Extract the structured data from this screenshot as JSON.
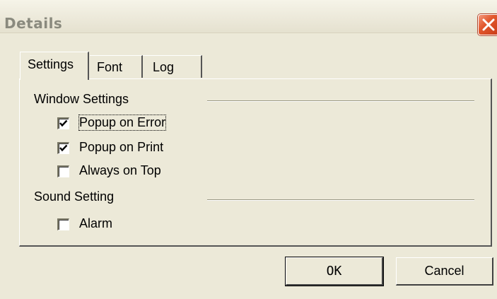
{
  "window": {
    "title": "Details"
  },
  "tabs": [
    {
      "label": "Settings",
      "selected": true
    },
    {
      "label": "Font",
      "selected": false
    },
    {
      "label": "Log",
      "selected": false
    }
  ],
  "window_settings": {
    "heading": "Window Settings",
    "options": [
      {
        "label": "Popup on Error",
        "checked": true
      },
      {
        "label": "Popup on Print",
        "checked": true
      },
      {
        "label": "Always on Top",
        "checked": false
      }
    ]
  },
  "sound_setting": {
    "heading": "Sound Setting",
    "options": [
      {
        "label": "Alarm",
        "checked": false
      }
    ]
  },
  "buttons": {
    "ok_label": "OK",
    "cancel_label": "Cancel"
  },
  "icons": {
    "close": "close-icon",
    "check": "checkmark-icon"
  },
  "colors": {
    "close_button": "#E2582E",
    "dialog_background": "#ECE9D8"
  }
}
